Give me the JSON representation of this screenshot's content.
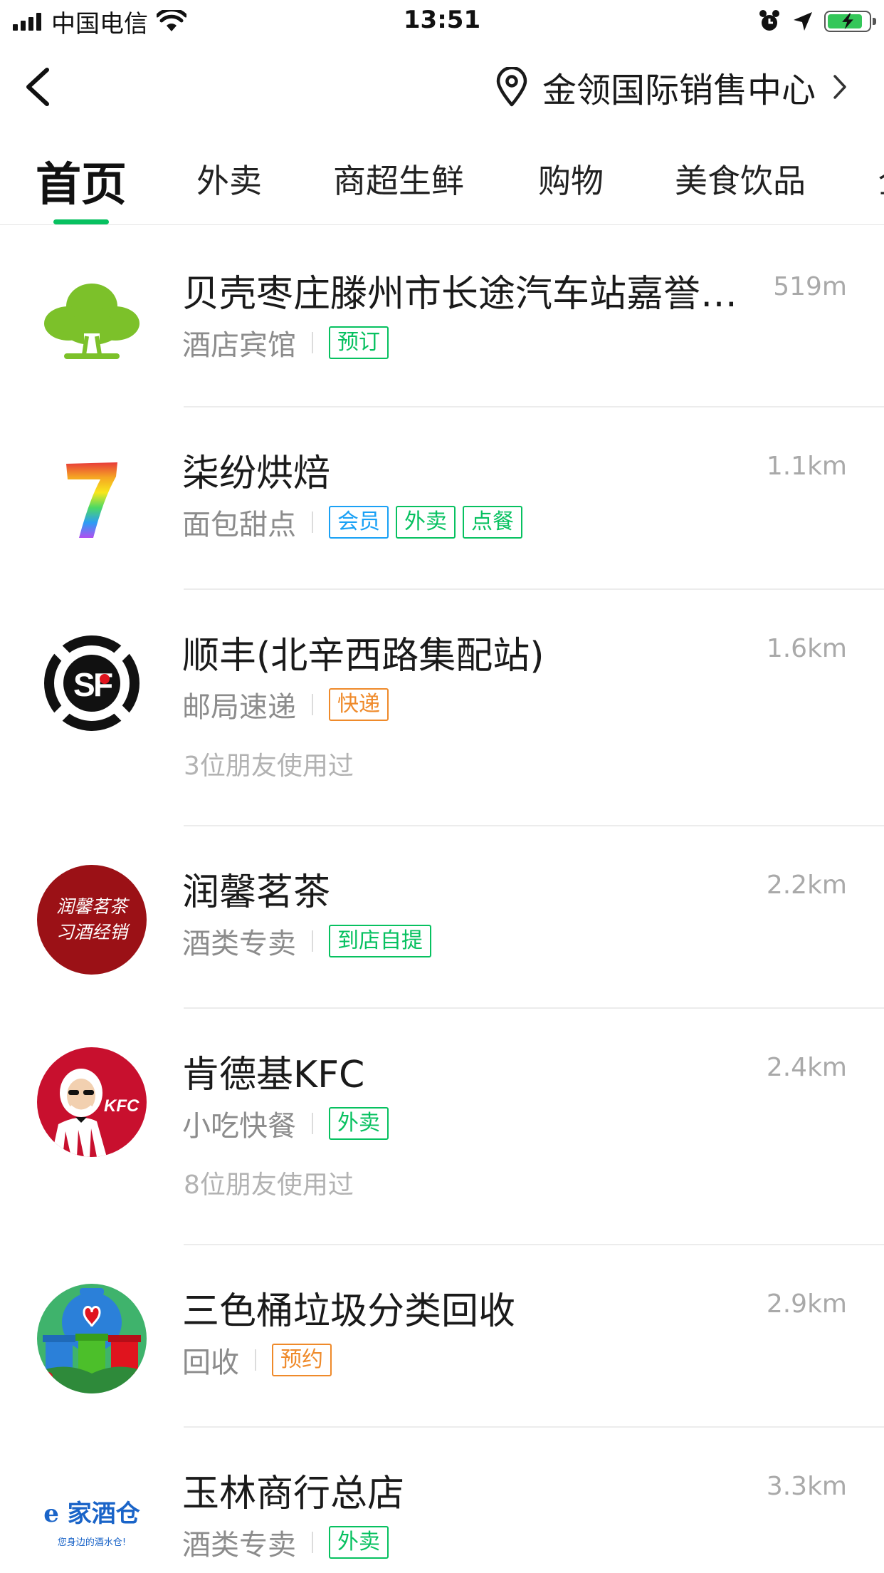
{
  "status_bar": {
    "carrier": "中国电信",
    "time": "13:51",
    "battery_level": 0.85,
    "battery_color": "#34c759"
  },
  "nav": {
    "back_icon": "chevron-left-icon",
    "location_icon": "map-pin-icon",
    "location": "金领国际销售中心"
  },
  "tabs": [
    {
      "label": "首页",
      "active": true
    },
    {
      "label": "外卖"
    },
    {
      "label": "商超生鲜"
    },
    {
      "label": "购物"
    },
    {
      "label": "美食饮品"
    }
  ],
  "accent_color": "#07c160",
  "items": [
    {
      "name": "贝壳枣庄滕州市长途汽车站嘉誉…",
      "distance": "519m",
      "category": "酒店宾馆",
      "tags": [
        {
          "label": "预订",
          "color": "green"
        }
      ],
      "logo": "tree-logo"
    },
    {
      "name": "柒纷烘焙",
      "distance": "1.1km",
      "category": "面包甜点",
      "tags": [
        {
          "label": "会员",
          "color": "blue"
        },
        {
          "label": "外卖",
          "color": "green"
        },
        {
          "label": "点餐",
          "color": "green"
        }
      ],
      "logo": "rainbow-seven-logo"
    },
    {
      "name": "顺丰(北辛西路集配站)",
      "distance": "1.6km",
      "category": "邮局速递",
      "tags": [
        {
          "label": "快递",
          "color": "orange"
        }
      ],
      "friends": "3位朋友使用过",
      "logo": "sf-express-logo"
    },
    {
      "name": "润馨茗茶",
      "distance": "2.2km",
      "category": "酒类专卖",
      "tags": [
        {
          "label": "到店自提",
          "color": "green"
        }
      ],
      "logo": "runxin-tea-logo",
      "logo_text_1": "润馨茗茶",
      "logo_text_2": "习酒经销"
    },
    {
      "name": "肯德基KFC",
      "distance": "2.4km",
      "category": "小吃快餐",
      "tags": [
        {
          "label": "外卖",
          "color": "green"
        }
      ],
      "friends": "8位朋友使用过",
      "logo": "kfc-logo",
      "logo_text": "KFC"
    },
    {
      "name": "三色桶垃圾分类回收",
      "distance": "2.9km",
      "category": "回收",
      "tags": [
        {
          "label": "预约",
          "color": "orange"
        }
      ],
      "logo": "recycle-bins-logo"
    },
    {
      "name": "玉林商行总店",
      "distance": "3.3km",
      "category": "酒类专卖",
      "tags": [
        {
          "label": "外卖",
          "color": "green"
        }
      ],
      "logo": "ejia-jiucang-logo",
      "logo_text_1": "e 家酒仓",
      "logo_text_2": "您身边的酒水仓!"
    }
  ]
}
